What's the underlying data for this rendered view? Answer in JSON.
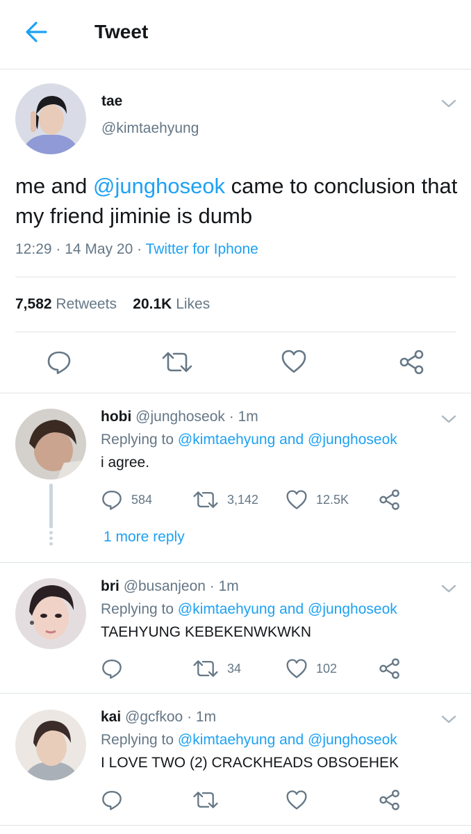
{
  "header": {
    "title": "Tweet",
    "back_icon": "arrow-left-icon",
    "accent": "#1da1f2"
  },
  "tweet": {
    "name": "tae",
    "handle": "@kimtaehyung",
    "text_before": "me and ",
    "mention": "@junghoseok",
    "text_after": " came to conclusion that my friend jiminie is dumb",
    "time": "12:29",
    "date": "14 May 20",
    "source": "Twitter for Iphone",
    "retweets_count": "7,582",
    "retweets_label": "Retweets",
    "likes_count": "20.1K",
    "likes_label": "Likes"
  },
  "replies": [
    {
      "name": "hobi",
      "handle": "@junghoseok",
      "time": "1m",
      "replying_prefix": "Replying to ",
      "replying_mention1": "@kimtaehyung",
      "replying_and": " and ",
      "replying_mention2": "@junghoseok",
      "text": "i agree.",
      "reply_count": "584",
      "retweet_count": "3,142",
      "like_count": "12.5K",
      "more_reply": "1 more reply"
    },
    {
      "name": "bri",
      "handle": "@busanjeon",
      "time": "1m",
      "replying_prefix": "Replying to ",
      "replying_mention1": "@kimtaehyung",
      "replying_and": " and ",
      "replying_mention2": "@junghoseok",
      "text": "TAEHYUNG KEBEKENWKWKN",
      "reply_count": "",
      "retweet_count": "34",
      "like_count": "102"
    },
    {
      "name": "kai",
      "handle": "@gcfkoo",
      "time": "1m",
      "replying_prefix": "Replying to ",
      "replying_mention1": "@kimtaehyung",
      "replying_and": " and ",
      "replying_mention2": "@junghoseok",
      "text": "I LOVE TWO (2) CRACKHEADS OBSOEHEK",
      "reply_count": "",
      "retweet_count": "",
      "like_count": ""
    }
  ],
  "separator": " · "
}
